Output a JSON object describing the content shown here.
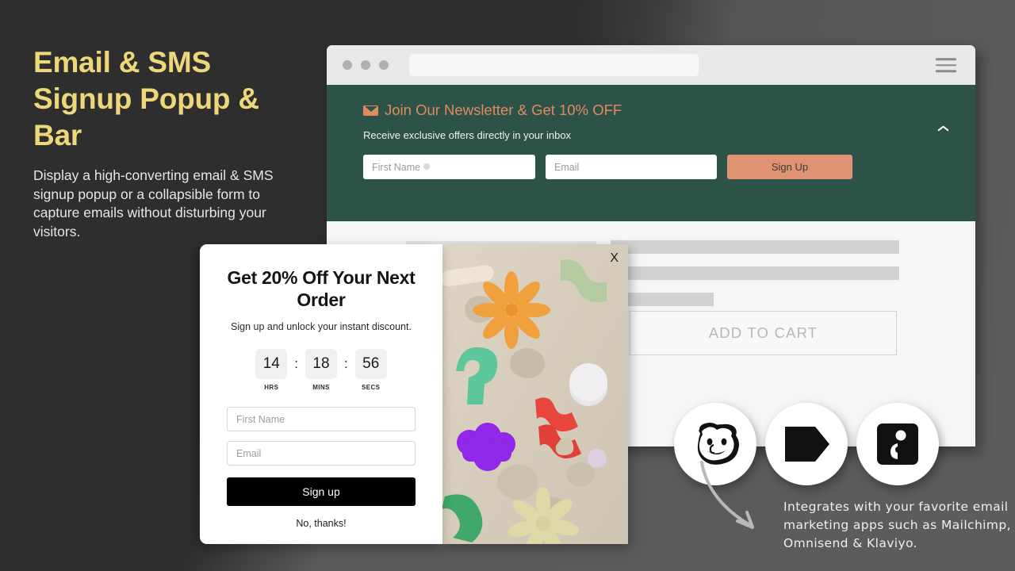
{
  "hero": {
    "title": "Email & SMS Signup Popup & Bar",
    "subtitle": "Display a high-converting email & SMS signup popup or a collapsible form to capture emails without disturbing your visitors.",
    "title_color": "#ecd87a"
  },
  "browser": {
    "url_value": "",
    "menu_icon": "hamburger-menu-icon",
    "dot_icons": [
      "window-dot",
      "window-dot",
      "window-dot"
    ]
  },
  "newsletter_bar": {
    "heading": "Join Our Newsletter & Get 10% OFF",
    "heading_icon": "envelope-icon",
    "subheading": "Receive exclusive offers directly in your inbox",
    "first_name_placeholder": "First Name",
    "email_placeholder": "Email",
    "signup_label": "Sign Up",
    "collapse_icon": "chevron-up-icon",
    "background_color": "#2d5349",
    "accent_color": "#e08a5f",
    "button_color": "#e09372"
  },
  "product_page": {
    "add_to_cart_label": "ADD TO CART"
  },
  "photo_panel": {
    "close_icon": "close-icon",
    "close_label": "X"
  },
  "popup": {
    "title": "Get 20% Off Your Next Order",
    "subtitle": "Sign up and unlock your instant discount.",
    "countdown": [
      {
        "value": "14",
        "label": "HRS"
      },
      {
        "value": "18",
        "label": "MINS"
      },
      {
        "value": "56",
        "label": "SECS"
      }
    ],
    "colon": ":",
    "first_name_placeholder": "First Name",
    "email_placeholder": "Email",
    "signup_label": "Sign up",
    "decline_label": "No, thanks!",
    "button_color": "#000000"
  },
  "integrations": {
    "logos": [
      {
        "name": "mailchimp-logo"
      },
      {
        "name": "klaviyo-logo"
      },
      {
        "name": "omnisend-logo"
      }
    ],
    "caption": "Integrates with your favorite email marketing apps such as Mailchimp, Omnisend & Klaviyo."
  }
}
